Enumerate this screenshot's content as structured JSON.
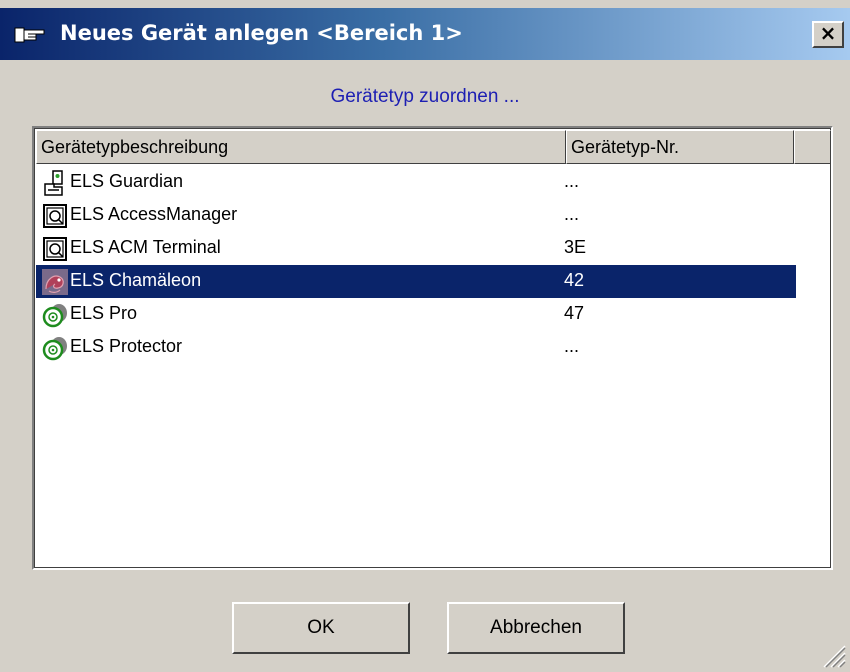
{
  "window": {
    "title": "Neues Gerät anlegen <Bereich 1>",
    "close_label": "×"
  },
  "dialog": {
    "subtitle": "Gerätetyp zuordnen ..."
  },
  "list": {
    "columns": [
      "Gerätetypbeschreibung",
      "Gerätetyp-Nr."
    ],
    "rows": [
      {
        "desc": "ELS Guardian",
        "nr": "...",
        "icon": "guardian-icon"
      },
      {
        "desc": "ELS AccessManager",
        "nr": "...",
        "icon": "accessmanager-icon"
      },
      {
        "desc": "ELS ACM Terminal",
        "nr": "3E",
        "icon": "acm-terminal-icon"
      },
      {
        "desc": "ELS Chamäleon",
        "nr": "42",
        "icon": "chameleon-icon",
        "selected": true
      },
      {
        "desc": "ELS Pro",
        "nr": "47",
        "icon": "cylinder-icon"
      },
      {
        "desc": "ELS Protector",
        "nr": "...",
        "icon": "cylinder-icon"
      }
    ]
  },
  "buttons": {
    "ok": "OK",
    "cancel": "Abbrechen"
  },
  "colors": {
    "selection": "#0a246a",
    "subtitle": "#1d1fb3"
  }
}
